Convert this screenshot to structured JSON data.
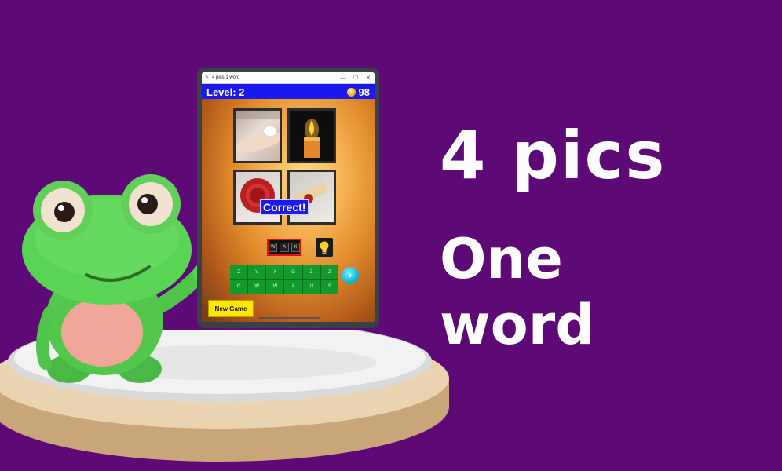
{
  "window": {
    "title": "4 pics 1 word",
    "minimize_glyph": "—",
    "maximize_glyph": "☐",
    "close_glyph": "✕"
  },
  "game": {
    "level_label": "Level: 2",
    "coins": "98",
    "feedback": "Correct!",
    "answer_letters": [
      "W",
      "A",
      "X"
    ],
    "keyboard_rows": [
      [
        "Z",
        "V",
        "X",
        "G",
        "Z",
        "Z"
      ],
      [
        "C",
        "W",
        "W",
        "A",
        "U",
        "S"
      ]
    ],
    "new_game_label": "New Game",
    "pictures": [
      "hair-removal-photo",
      "candle-photo",
      "wax-seal-photo",
      "sealed-scroll-photo"
    ]
  },
  "headline": {
    "line1": "4 pics",
    "line2": "One word"
  },
  "colors": {
    "background": "#5e0a76",
    "level_bar": "#1a19f0",
    "keyboard": "#129a2d",
    "new_game_button": "#ffe600",
    "answer_border": "#e21010"
  }
}
